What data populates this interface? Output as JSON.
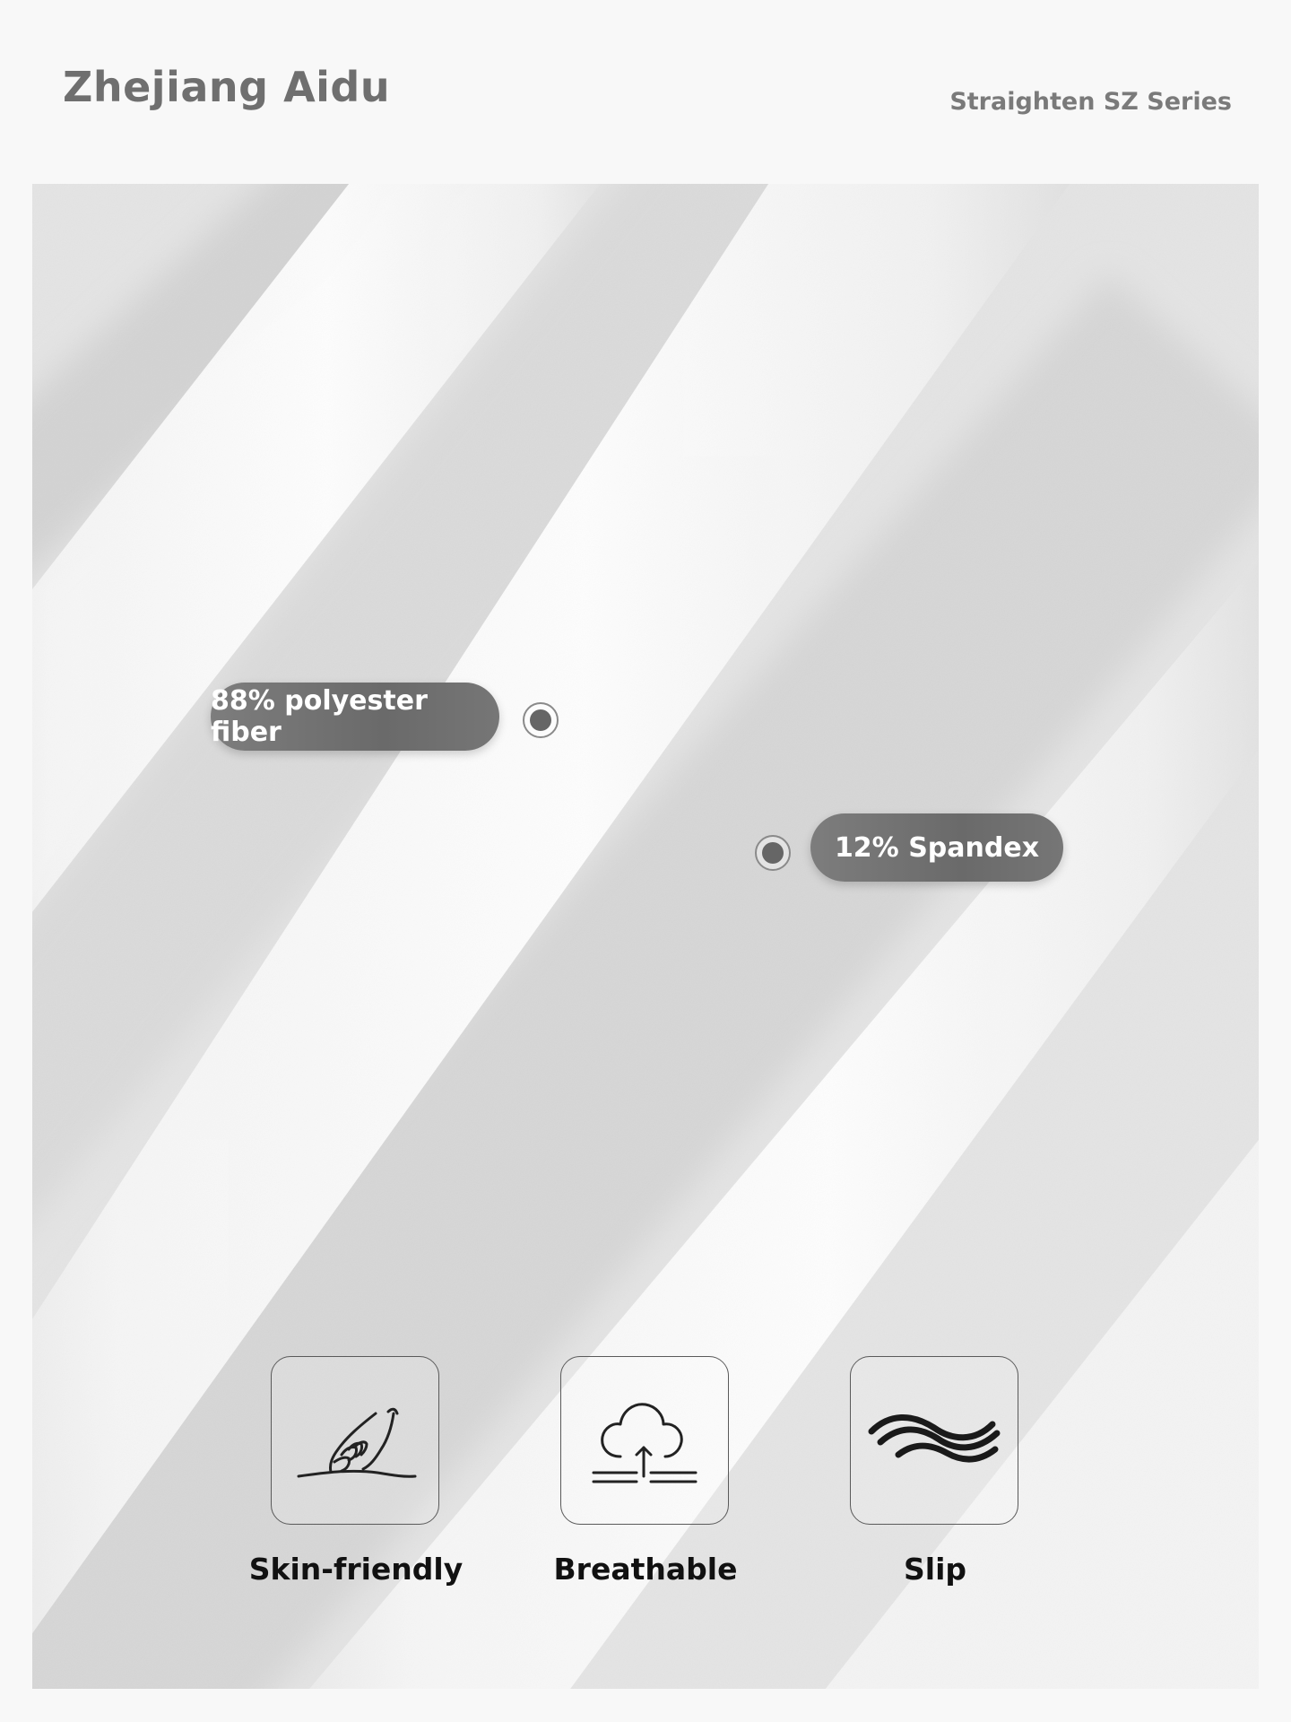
{
  "header": {
    "brand": "Zhejiang Aidu",
    "series": "Straighten SZ Series"
  },
  "materials": [
    {
      "label": "88% polyester fiber"
    },
    {
      "label": "12% Spandex"
    }
  ],
  "features": [
    {
      "label": "Skin-friendly",
      "icon": "hand-on-skin-icon"
    },
    {
      "label": "Breathable",
      "icon": "cloud-upload-icon"
    },
    {
      "label": "Slip",
      "icon": "waves-icon"
    }
  ],
  "colors": {
    "background": "#f8f8f8",
    "pill": "#707070",
    "brand_text": "#6f6f6f",
    "label_text": "#111111"
  }
}
